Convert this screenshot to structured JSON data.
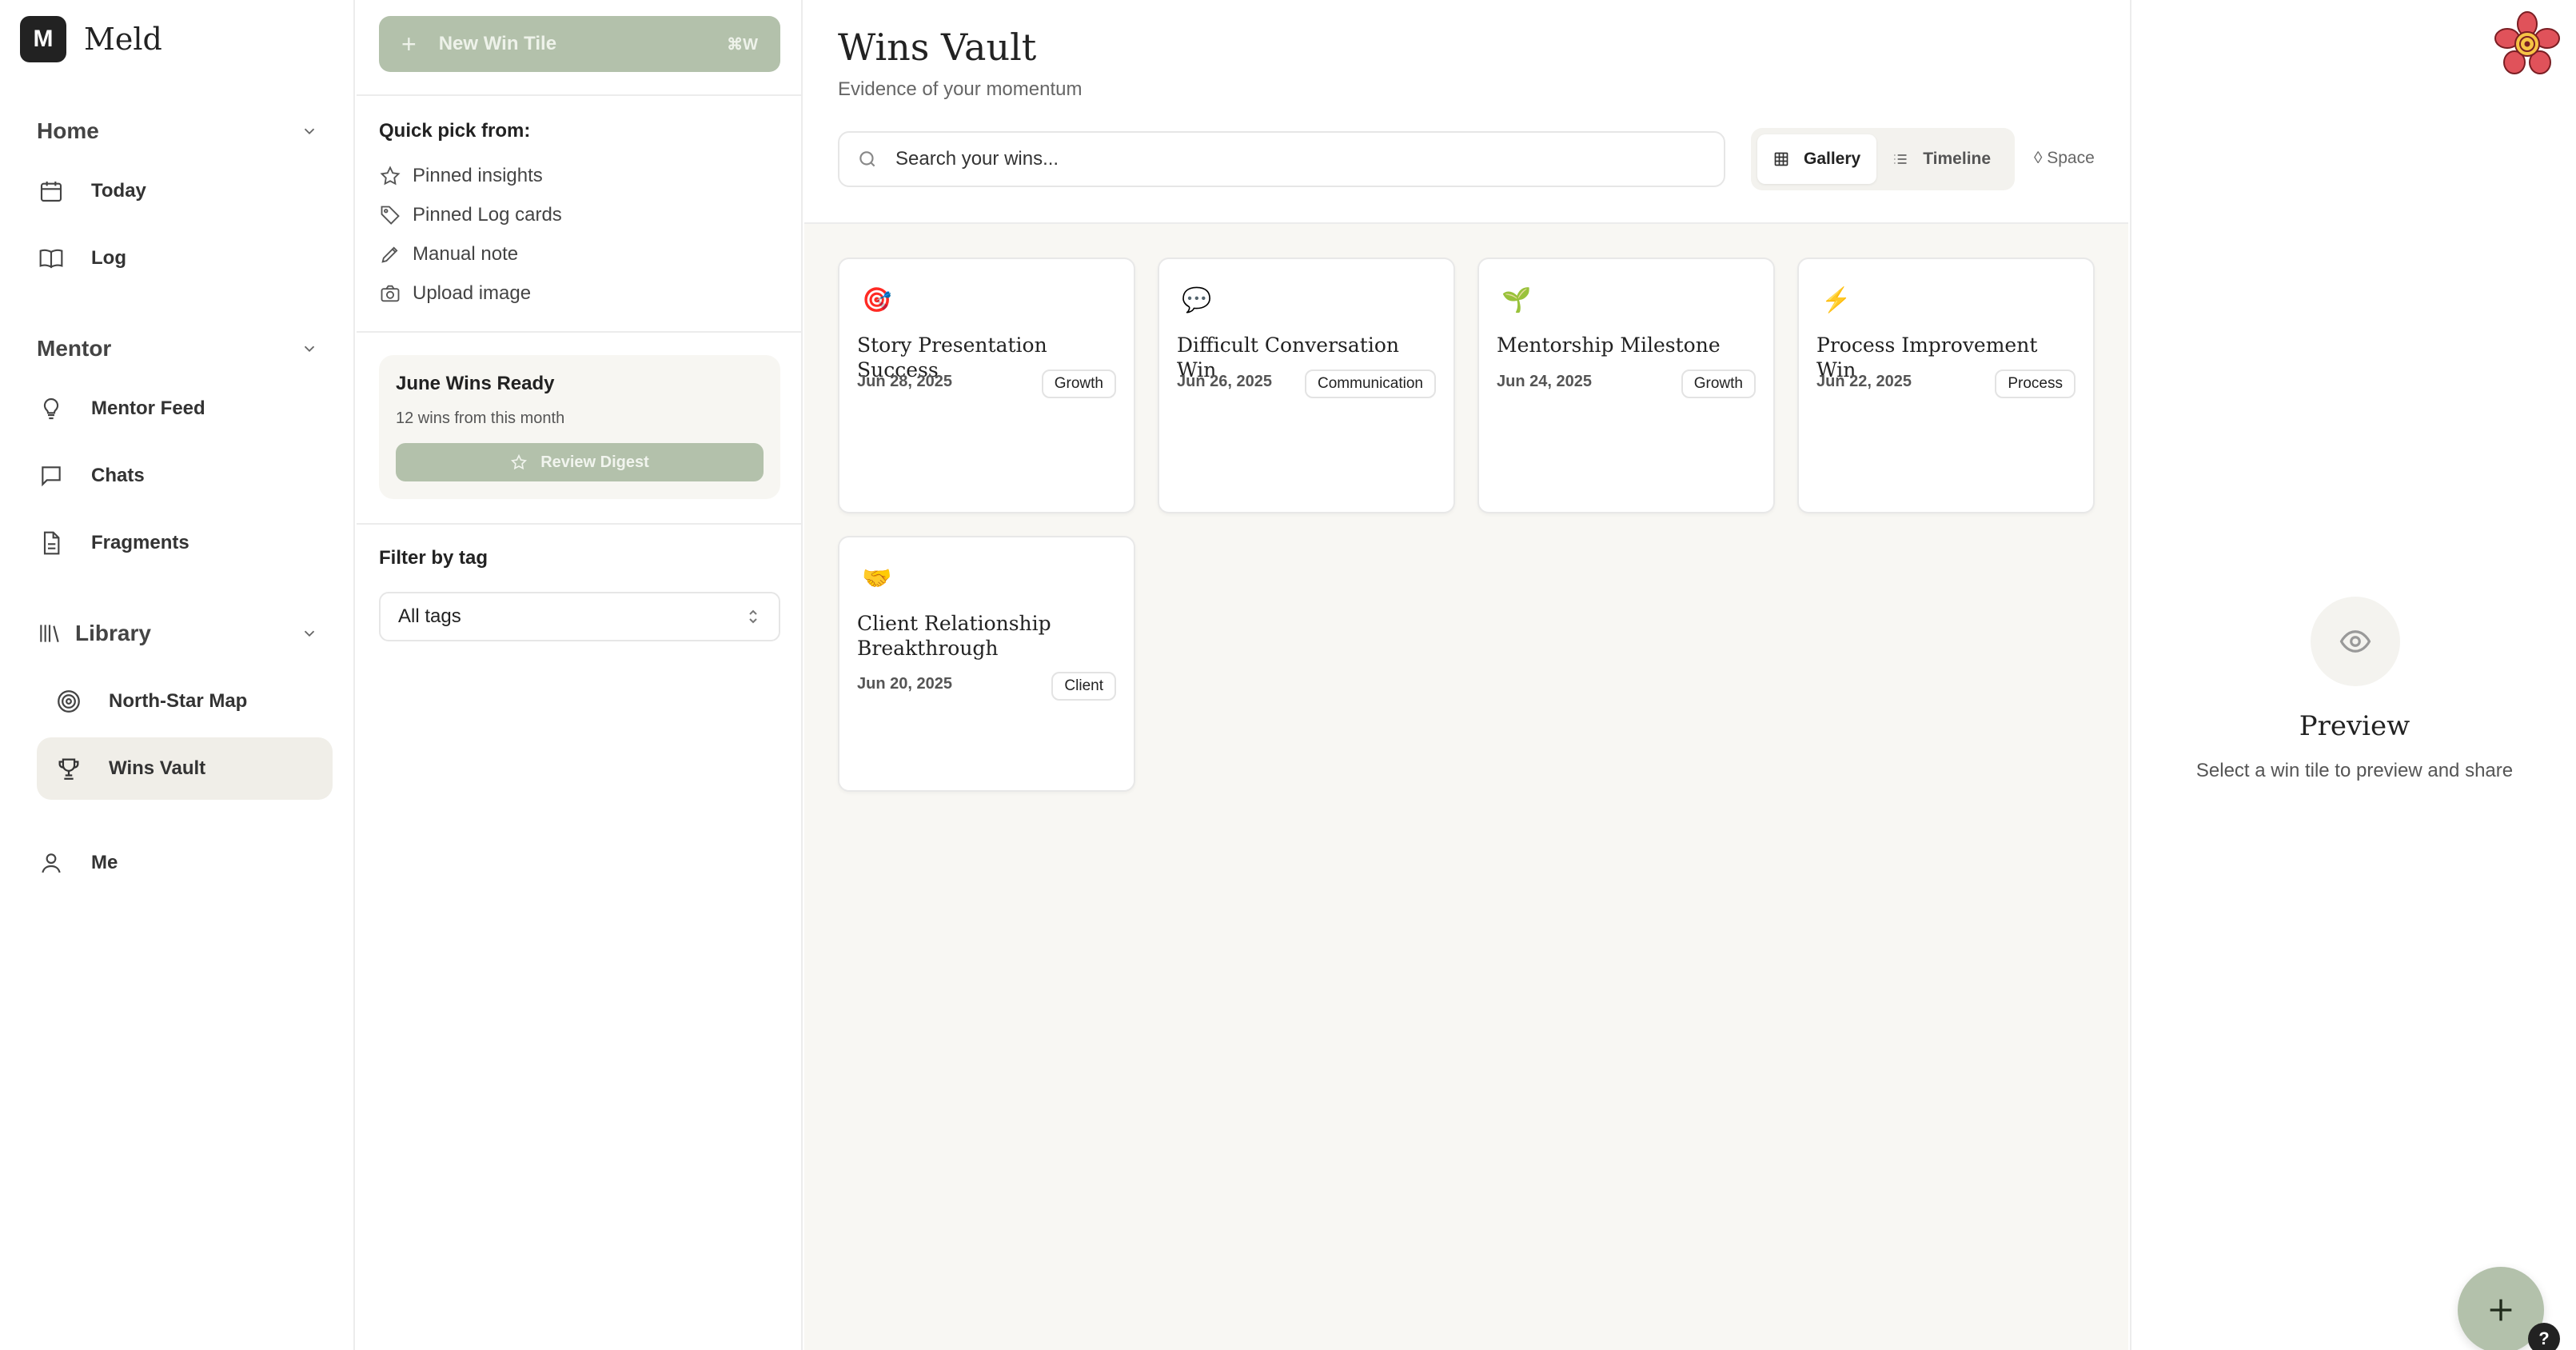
{
  "app": {
    "logo_letter": "M",
    "name": "Meld"
  },
  "sidebar": {
    "home": {
      "label": "Home",
      "items": [
        {
          "label": "Today",
          "icon": "calendar-icon"
        },
        {
          "label": "Log",
          "icon": "book-icon"
        }
      ]
    },
    "mentor": {
      "label": "Mentor",
      "items": [
        {
          "label": "Mentor Feed",
          "icon": "lightbulb-icon"
        },
        {
          "label": "Chats",
          "icon": "chat-icon"
        },
        {
          "label": "Fragments",
          "icon": "document-icon"
        }
      ]
    },
    "library": {
      "label": "Library",
      "items": [
        {
          "label": "North-Star Map",
          "icon": "target-icon"
        },
        {
          "label": "Wins Vault",
          "icon": "trophy-icon",
          "active": true
        }
      ]
    },
    "me": {
      "label": "Me",
      "icon": "user-icon"
    }
  },
  "panel": {
    "new_button": {
      "label": "New Win Tile",
      "shortcut": "⌘W"
    },
    "quick_pick_title": "Quick pick from:",
    "quick_pick": [
      {
        "label": "Pinned insights",
        "icon": "star-icon"
      },
      {
        "label": "Pinned Log cards",
        "icon": "tag-icon"
      },
      {
        "label": "Manual note",
        "icon": "pencil-icon"
      },
      {
        "label": "Upload image",
        "icon": "camera-icon"
      }
    ],
    "digest": {
      "title": "June Wins Ready",
      "subtitle": "12 wins from this month",
      "button": "Review Digest"
    },
    "filter_title": "Filter by tag",
    "filter_value": "All tags"
  },
  "main": {
    "title": "Wins Vault",
    "subtitle": "Evidence of your momentum",
    "search_placeholder": "Search your wins...",
    "views": [
      {
        "label": "Gallery",
        "active": true
      },
      {
        "label": "Timeline",
        "active": false
      }
    ],
    "space_label": "◊ Space",
    "cards": [
      {
        "emoji": "🎯",
        "title": "Story Presentation Success",
        "date": "Jun 28, 2025",
        "tag": "Growth"
      },
      {
        "emoji": "💬",
        "title": "Difficult Conversation Win",
        "date": "Jun 26, 2025",
        "tag": "Communication"
      },
      {
        "emoji": "🌱",
        "title": "Mentorship Milestone",
        "date": "Jun 24, 2025",
        "tag": "Growth"
      },
      {
        "emoji": "⚡",
        "title": "Process Improvement Win",
        "date": "Jun 22, 2025",
        "tag": "Process"
      },
      {
        "emoji": "🤝",
        "title": "Client Relationship Breakthrough",
        "date": "Jun 20, 2025",
        "tag": "Client"
      }
    ]
  },
  "preview": {
    "title": "Preview",
    "subtitle": "Select a win tile to preview and share",
    "help_label": "?"
  },
  "colors": {
    "accent": "#b3c1ab",
    "background": "#f8f7f3",
    "active_nav": "#f0eee8"
  }
}
